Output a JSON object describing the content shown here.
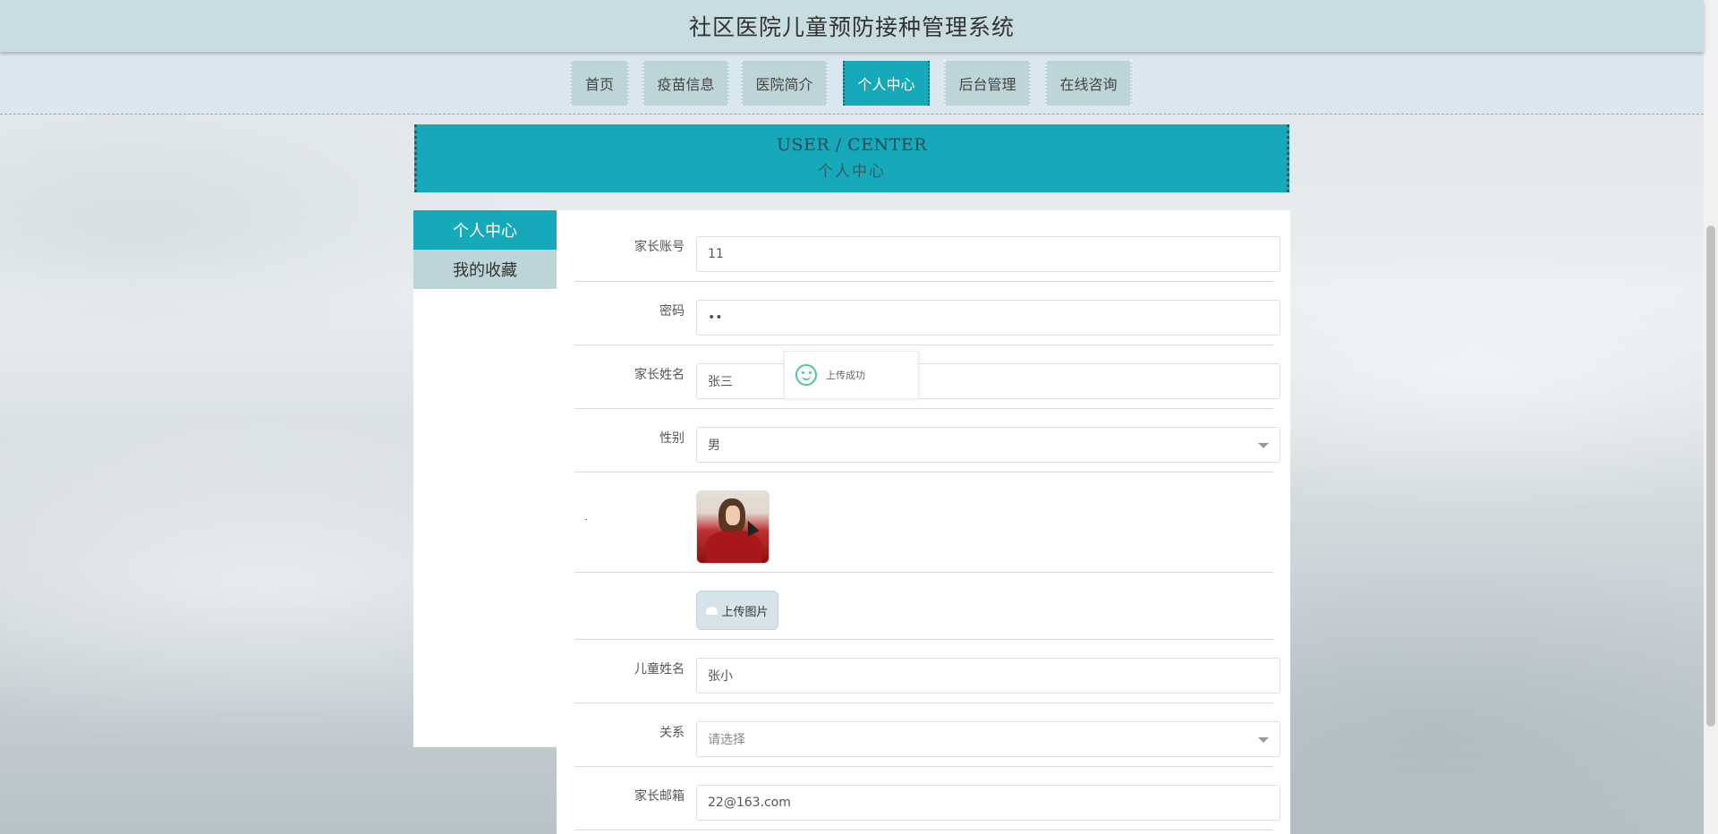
{
  "header": {
    "title": "社区医院儿童预防接种管理系统"
  },
  "nav": {
    "items": [
      {
        "label": "首页"
      },
      {
        "label": "疫苗信息"
      },
      {
        "label": "医院简介"
      },
      {
        "label": "个人中心",
        "active": true
      },
      {
        "label": "后台管理"
      },
      {
        "label": "在线咨询"
      }
    ]
  },
  "banner": {
    "en": "USER / CENTER",
    "cn": "个人中心"
  },
  "sidebar": {
    "items": [
      {
        "label": "个人中心",
        "active": true
      },
      {
        "label": "我的收藏"
      }
    ]
  },
  "form": {
    "account": {
      "label": "家长账号",
      "value": "11"
    },
    "password": {
      "label": "密码",
      "value": "••"
    },
    "parent_name": {
      "label": "家长姓名",
      "value": "张三"
    },
    "gender": {
      "label": "性别",
      "value": "男"
    },
    "photo": {
      "mark": "-"
    },
    "upload": {
      "label": "上传图片"
    },
    "child_name": {
      "label": "儿童姓名",
      "value": "张小"
    },
    "relation": {
      "label": "关系",
      "placeholder": "请选择"
    },
    "email": {
      "label": "家长邮箱",
      "value": "22@163.com"
    }
  },
  "toast": {
    "message": "上传成功",
    "icon": "smile-icon"
  },
  "colors": {
    "accent": "#15a9b9",
    "nav_bg": "#bdd5d9",
    "topbar_bg": "#c8dde2",
    "success": "#4dc88f"
  }
}
